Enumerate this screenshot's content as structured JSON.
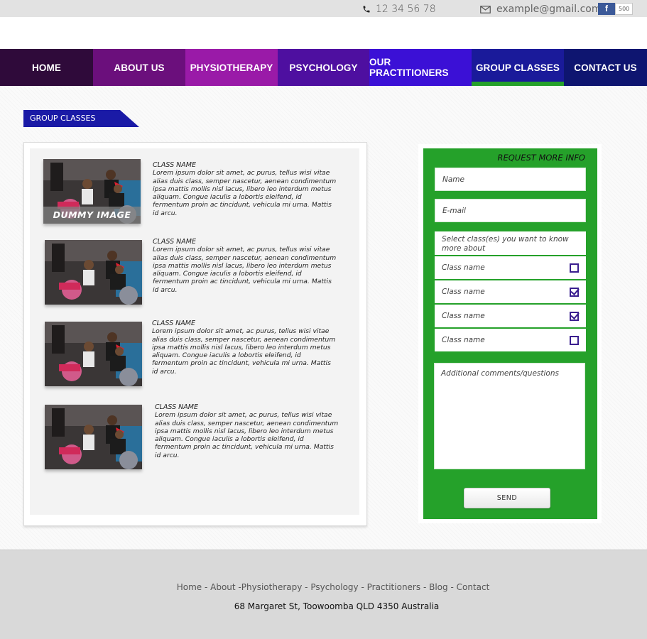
{
  "topbar": {
    "phone": "12 34 56 78",
    "email": "example@gmail.com",
    "facebook_letter": "f",
    "facebook_count": "500"
  },
  "nav": {
    "items": [
      {
        "label": "HOME",
        "color": "#2f0a3a"
      },
      {
        "label": "ABOUT US",
        "color": "#6b0f7c"
      },
      {
        "label": "PHYSIOTHERAPY",
        "color": "#9a1aa8"
      },
      {
        "label": "PSYCHOLOGY",
        "color": "#4e0fa0"
      },
      {
        "label": "OUR PRACTITIONERS",
        "color": "#3b10d6"
      },
      {
        "label": "GROUP CLASSES",
        "color": "#1a1a9a",
        "active": true
      },
      {
        "label": "CONTACT US",
        "color": "#0e1570"
      }
    ]
  },
  "section": {
    "title": "GROUP CLASSES"
  },
  "classes": [
    {
      "name": "CLASS NAME",
      "description": "Lorem ipsum dolor sit amet, ac purus, tellus wisi vitae alias duis class, semper nascetur, aenean condimentum ipsa mattis mollis nisl lacus, libero leo interdum metus aliquam. Congue iaculis a lobortis eleifend, id fermentum proin ac tincidunt, vehicula mi urna. Mattis id arcu.",
      "overlay": "DUMMY IMAGE"
    },
    {
      "name": "CLASS NAME",
      "description": "Lorem ipsum dolor sit amet, ac purus, tellus wisi vitae alias duis class, semper nascetur, aenean condimentum ipsa mattis mollis nisl lacus, libero leo interdum metus aliquam. Congue iaculis a lobortis eleifend, id fermentum proin ac tincidunt, vehicula mi urna. Mattis id arcu."
    },
    {
      "name": "CLASS NAME",
      "description": "Lorem ipsum dolor sit amet, ac purus, tellus wisi vitae alias duis class, semper nascetur, aenean condimentum ipsa mattis mollis nisl lacus, libero leo interdum metus aliquam. Congue iaculis a lobortis eleifend, id fermentum proin ac tincidunt, vehicula mi urna. Mattis id arcu."
    },
    {
      "name": "CLASS NAME",
      "description": "Lorem ipsum dolor sit amet, ac purus, tellus wisi vitae alias duis class, semper nascetur, aenean condimentum ipsa mattis mollis nisl lacus, libero leo interdum metus aliquam. Congue iaculis a lobortis eleifend, id fermentum proin ac tincidunt, vehicula mi urna. Mattis id arcu."
    }
  ],
  "form": {
    "title": "REQUEST MORE INFO",
    "name_placeholder": "Name",
    "email_placeholder": "E-mail",
    "select_prompt": "Select class(es) you want to know more about",
    "options": [
      {
        "label": "Class name",
        "checked": false
      },
      {
        "label": "Class name",
        "checked": true
      },
      {
        "label": "Class name",
        "checked": true
      },
      {
        "label": "Class name",
        "checked": false
      }
    ],
    "comments_placeholder": "Additional comments/questions",
    "send_label": "SEND",
    "panel_color": "#25a12a"
  },
  "footer": {
    "links": [
      "Home",
      "About",
      "Physiotherapy",
      "Psychology",
      "Practitioners",
      "Blog",
      "Contact"
    ],
    "address": "68 Margaret St, Toowoomba QLD 4350 Australia"
  }
}
